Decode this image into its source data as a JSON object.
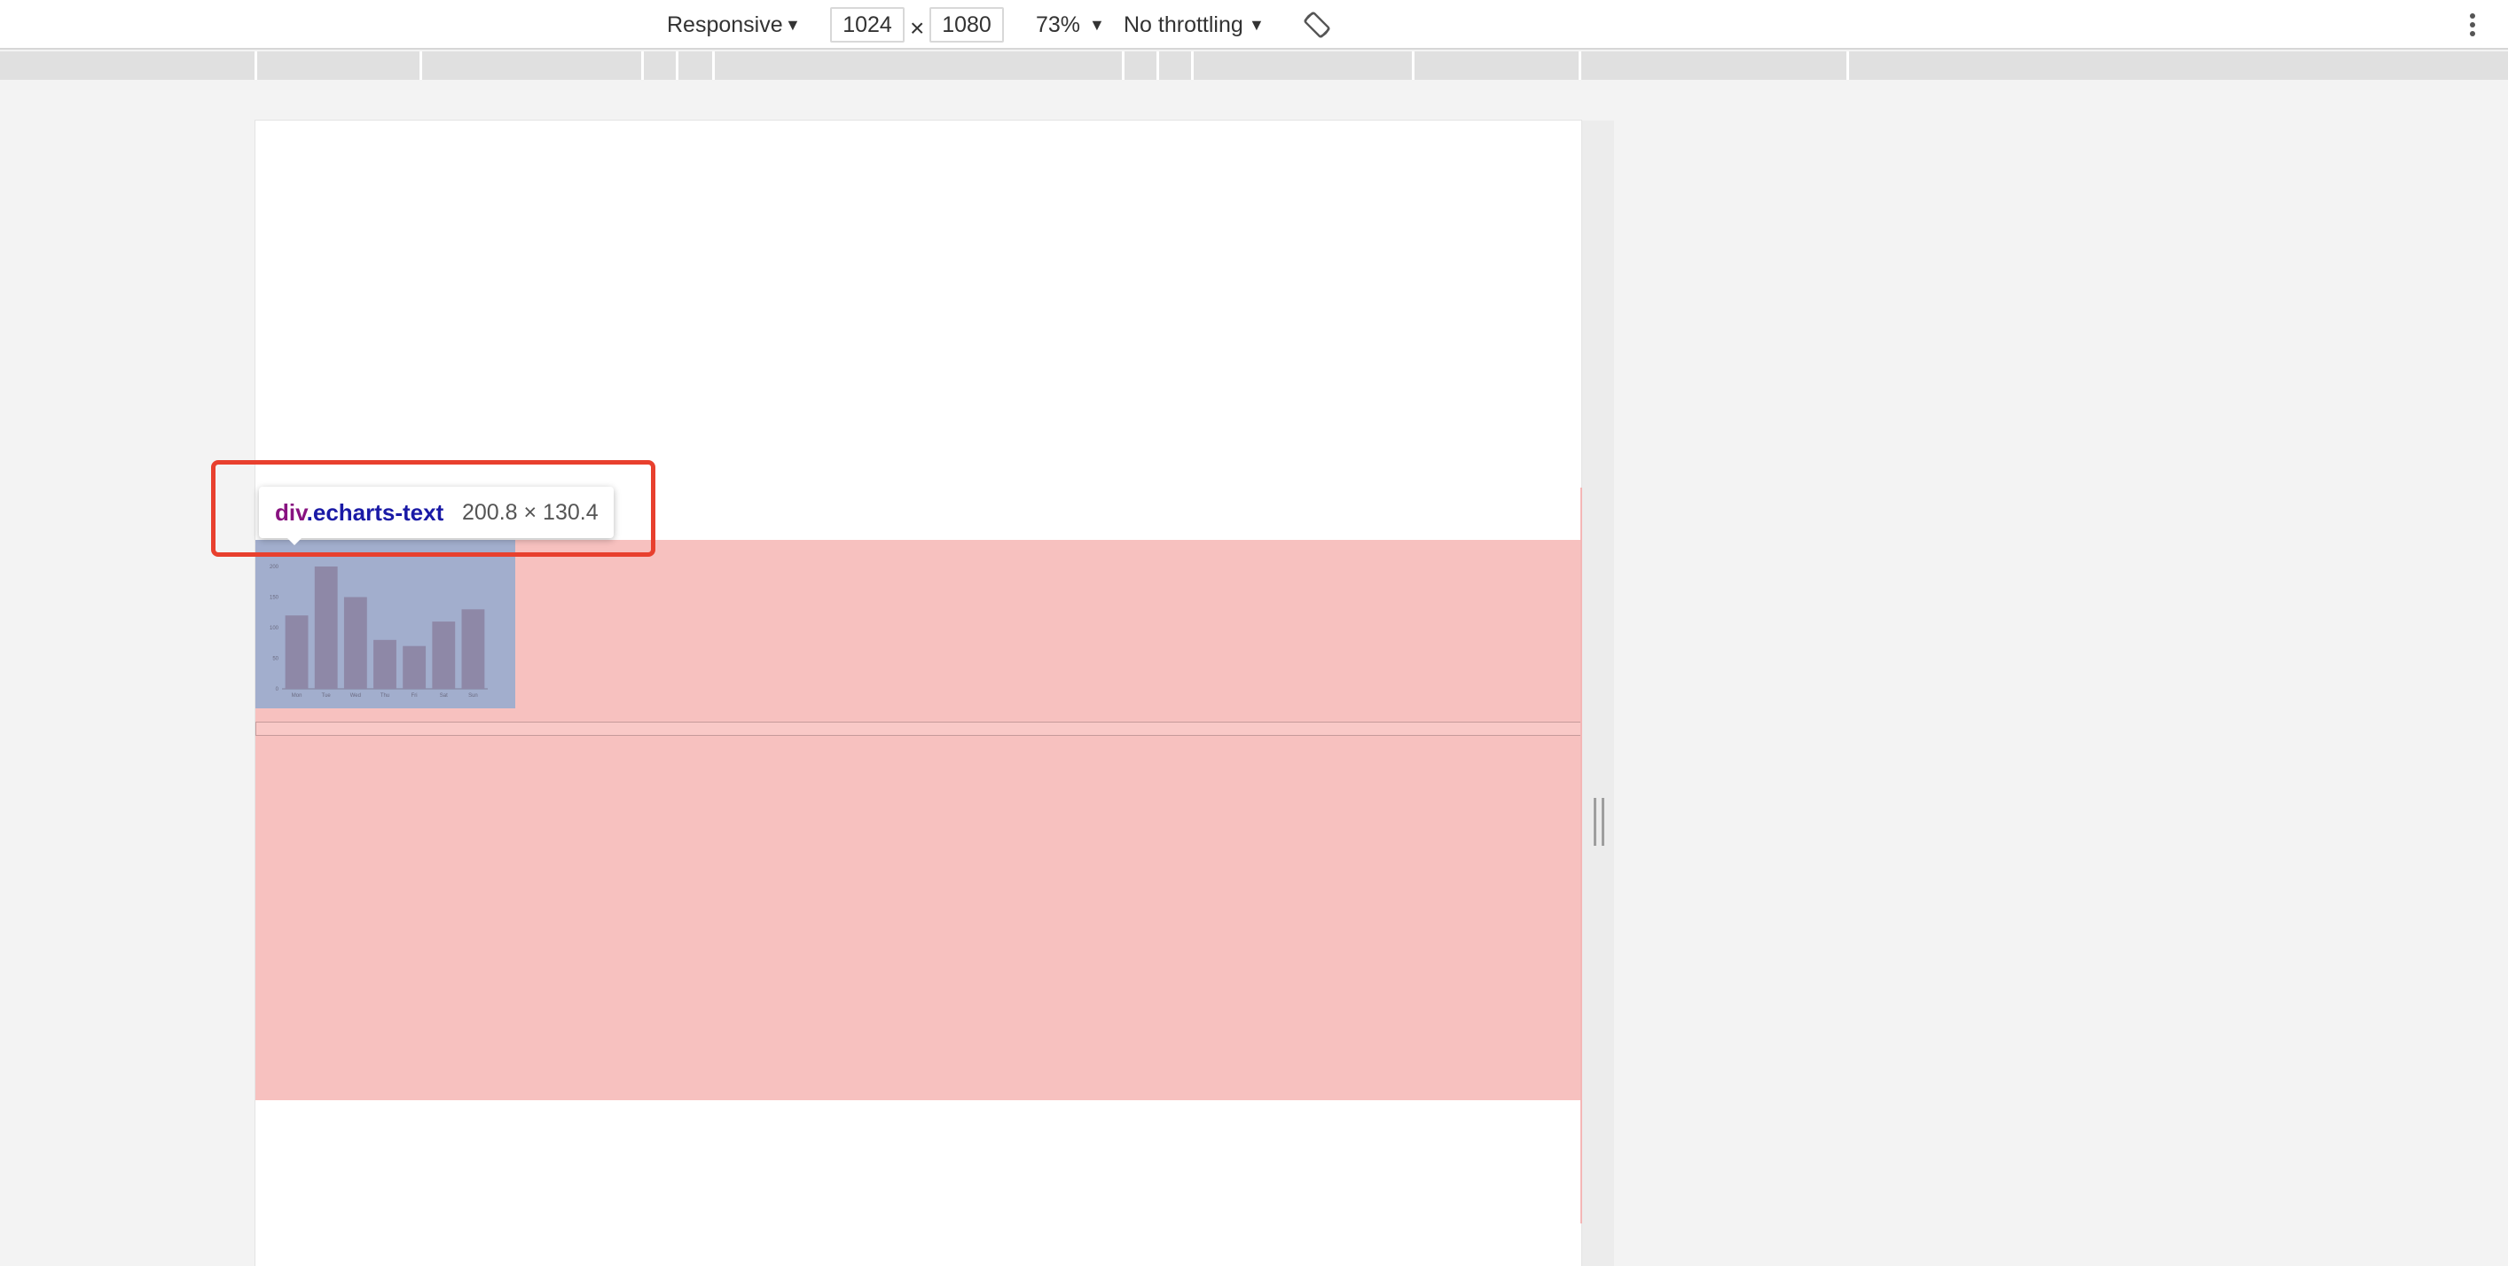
{
  "device_toolbar": {
    "device_label": "Responsive",
    "width_value": "1024",
    "times_symbol": "×",
    "height_value": "1080",
    "zoom_label": "73%",
    "throttling_label": "No throttling",
    "dropdown_arrow": "▼",
    "rotate_icon": "rotate-icon",
    "more_icon": "more-vert-icon"
  },
  "inspector_tooltip": {
    "tag": "div",
    "class_name": ".echarts-text",
    "size": "200.8 × 130.4"
  },
  "chart_data": {
    "type": "bar",
    "categories": [
      "Mon",
      "Tue",
      "Wed",
      "Thu",
      "Fri",
      "Sat",
      "Sun"
    ],
    "values": [
      120,
      200,
      150,
      80,
      70,
      110,
      130
    ],
    "ylim": [
      0,
      200
    ],
    "yticks": [
      "0",
      "50",
      "100",
      "150",
      "200"
    ],
    "grid": false,
    "bar_color": "#8e88a7"
  },
  "colors": {
    "container_highlight": "#f7c1bf",
    "element_highlight": "#a2aecd",
    "annotation": "#e8402e"
  }
}
